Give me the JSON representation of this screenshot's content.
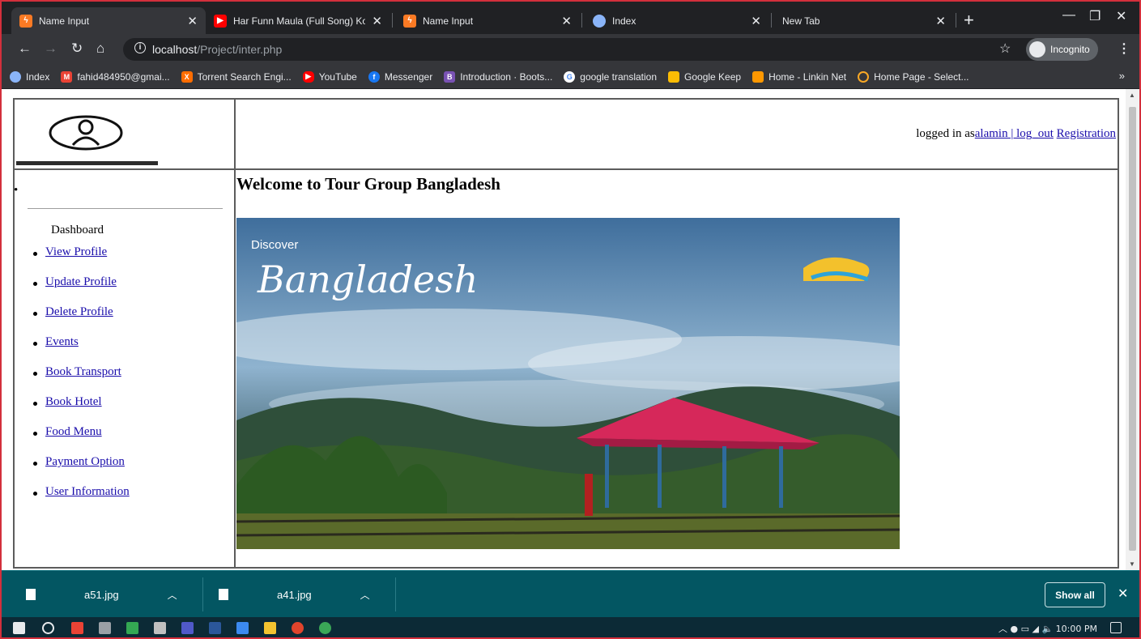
{
  "browser": {
    "tabs": [
      {
        "label": "Name Input",
        "favicon": "xampp-icon",
        "color": "#fb7a24",
        "active": true
      },
      {
        "label": "Har Funn Maula (Full Song) Ko",
        "favicon": "youtube-icon",
        "color": "#ff0000",
        "active": false
      },
      {
        "label": "Name Input",
        "favicon": "xampp-icon",
        "color": "#fb7a24",
        "active": false
      },
      {
        "label": "Index",
        "favicon": "globe-icon",
        "color": "#8ab4f8",
        "active": false
      },
      {
        "label": "New Tab",
        "favicon": "none",
        "color": "",
        "active": false
      }
    ],
    "url_host": "localhost",
    "url_path": "/Project/inter.php",
    "incognito_label": "Incognito",
    "bookmarks": [
      {
        "label": "Index",
        "color": "#8ab4f8"
      },
      {
        "label": "fahid484950@gmai...",
        "color": "#ea4335"
      },
      {
        "label": "Torrent Search Engi...",
        "color": "#ff6d00"
      },
      {
        "label": "YouTube",
        "color": "#ff0000"
      },
      {
        "label": "Messenger",
        "color": "#1877f2"
      },
      {
        "label": "Introduction · Boots...",
        "color": "#7952b3"
      },
      {
        "label": "google translation",
        "color": "#4285f4"
      },
      {
        "label": "Google Keep",
        "color": "#fbbc04"
      },
      {
        "label": "Home - Linkin Net",
        "color": "#ff9800"
      },
      {
        "label": "Home Page - Select...",
        "color": "#f9a825"
      }
    ]
  },
  "page": {
    "login_text": "logged in as",
    "user_link": "alamin | log_out",
    "registration_link": "Registration",
    "dashboard_label": "Dashboard",
    "menu": [
      "View Profile",
      "Update Profile",
      "Delete Profile",
      "Events",
      "Book Transport",
      "Book Hotel",
      "Food Menu",
      "Payment Option",
      "User Information"
    ],
    "welcome": "Welcome to Tour Group Bangladesh",
    "hero_small": "Discover",
    "hero_big": "Bangladesh"
  },
  "downloads": {
    "items": [
      "a51.jpg",
      "a41.jpg"
    ],
    "show_all": "Show all"
  },
  "taskbar": {
    "time": "10:00 PM"
  }
}
